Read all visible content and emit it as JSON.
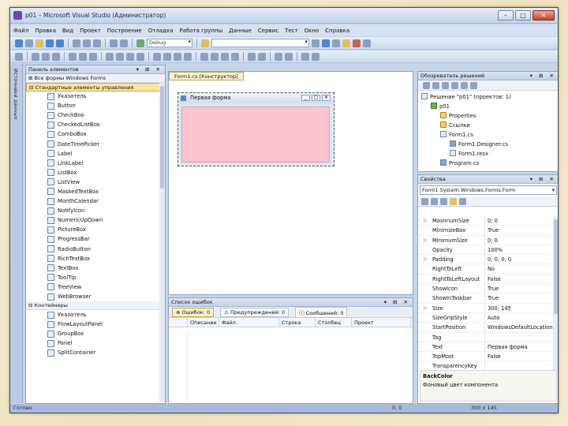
{
  "window": {
    "title": "p01 – Microsoft Visual Studio (Администратор)",
    "buttons": {
      "minimize": "–",
      "maximize": "□",
      "close": "✕"
    }
  },
  "menu": [
    "Файл",
    "Правка",
    "Вид",
    "Проект",
    "Построение",
    "Отладка",
    "Работа группы",
    "Данные",
    "Сервис",
    "Тест",
    "Окно",
    "Справка"
  ],
  "toolbar": {
    "config_combo": "Debug"
  },
  "side_strip_label": "Источники данных",
  "toolbox": {
    "title": "Панель элементов",
    "group_all": "Все формы Windows Forms",
    "group_common": "Стандартные элементы управления",
    "items": [
      "Указатель",
      "Button",
      "CheckBox",
      "CheckedListBox",
      "ComboBox",
      "DateTimePicker",
      "Label",
      "LinkLabel",
      "ListBox",
      "ListView",
      "MaskedTextBox",
      "MonthCalendar",
      "NotifyIcon",
      "NumericUpDown",
      "PictureBox",
      "ProgressBar",
      "RadioButton",
      "RichTextBox",
      "TextBox",
      "ToolTip",
      "TreeView",
      "WebBrowser"
    ],
    "group_containers": "Контейнеры",
    "containers": [
      "Указатель",
      "FlowLayoutPanel",
      "GroupBox",
      "Panel",
      "SplitContainer"
    ]
  },
  "designer": {
    "tab": "Form1.cs [Конструктор]",
    "form_title": "Первая форма",
    "form_back_color": "#fbc6cf"
  },
  "errors": {
    "title": "Список ошибок",
    "tab_errors": "Ошибок: 0",
    "tab_warnings": "Предупреждений: 0",
    "tab_messages": "Сообщений: 0",
    "columns": [
      "",
      "Описание",
      "Файл",
      "Строка",
      "Столбец",
      "Проект"
    ]
  },
  "solution": {
    "title": "Обозреватель решений",
    "nodes": [
      {
        "label": "Решение \"p01\" (проектов: 1)",
        "icon": "solution-icon",
        "indent": 0
      },
      {
        "label": "p01",
        "icon": "project-icon",
        "indent": 1
      },
      {
        "label": "Properties",
        "icon": "folder-icon",
        "indent": 2
      },
      {
        "label": "Ссылки",
        "icon": "folder-icon",
        "indent": 2
      },
      {
        "label": "Form1.cs",
        "icon": "form-icon",
        "indent": 2
      },
      {
        "label": "Form1.Designer.cs",
        "icon": "cs-file-icon",
        "indent": 3
      },
      {
        "label": "Form1.resx",
        "icon": "resx-icon",
        "indent": 3
      },
      {
        "label": "Program.cs",
        "icon": "cs-file-icon",
        "indent": 2
      }
    ]
  },
  "properties": {
    "title": "Свойства",
    "object": "Form1 System.Windows.Forms.Form",
    "rows": [
      {
        "name": "MaximumSize",
        "value": "0; 0",
        "expandable": true
      },
      {
        "name": "MinimizeBox",
        "value": "True",
        "expandable": false
      },
      {
        "name": "MinimumSize",
        "value": "0; 0",
        "expandable": true
      },
      {
        "name": "Opacity",
        "value": "100%",
        "expandable": false
      },
      {
        "name": "Padding",
        "value": "0; 0; 0; 0",
        "expandable": true
      },
      {
        "name": "RightToLeft",
        "value": "No",
        "expandable": false
      },
      {
        "name": "RightToLeftLayout",
        "value": "False",
        "expandable": false
      },
      {
        "name": "ShowIcon",
        "value": "True",
        "expandable": false
      },
      {
        "name": "ShowInTaskbar",
        "value": "True",
        "expandable": false
      },
      {
        "name": "Size",
        "value": "300; 145",
        "expandable": true
      },
      {
        "name": "SizeGripStyle",
        "value": "Auto",
        "expandable": false
      },
      {
        "name": "StartPosition",
        "value": "WindowsDefaultLocation",
        "expandable": false
      },
      {
        "name": "Tag",
        "value": "",
        "expandable": false
      },
      {
        "name": "Text",
        "value": "Первая форма",
        "expandable": false
      },
      {
        "name": "TopMost",
        "value": "False",
        "expandable": false
      },
      {
        "name": "TransparencyKey",
        "value": "",
        "expandable": false
      }
    ],
    "desc_title": "BackColor",
    "desc_text": "Фоновый цвет компонента"
  },
  "status": {
    "text": "Готово",
    "position": "0, 0",
    "size": "300 x 145"
  }
}
